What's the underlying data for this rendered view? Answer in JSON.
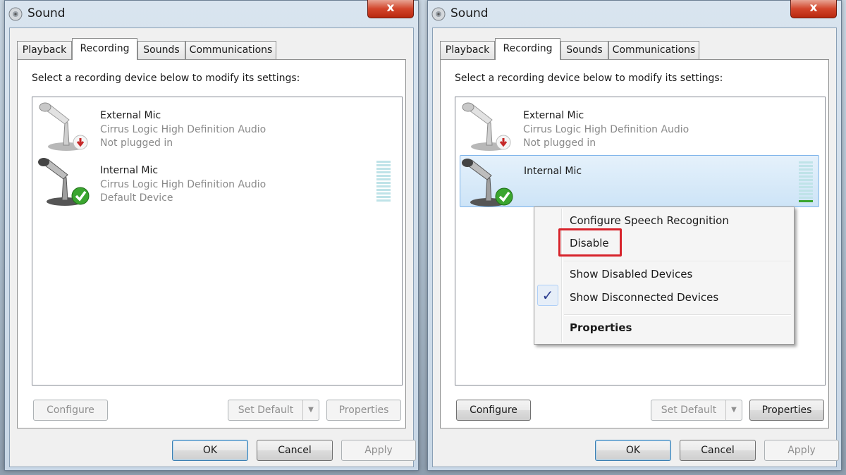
{
  "dialogs": [
    {
      "title": "Sound",
      "close_symbol": "x",
      "tabs": [
        "Playback",
        "Recording",
        "Sounds",
        "Communications"
      ],
      "active_tab": "Recording",
      "instruction": "Select a recording device below to modify its settings:",
      "devices": [
        {
          "name": "External Mic",
          "driver": "Cirrus Logic High Definition Audio",
          "status": "Not plugged in"
        },
        {
          "name": "Internal Mic",
          "driver": "Cirrus Logic High Definition Audio",
          "status": "Default Device"
        }
      ],
      "panel_buttons": {
        "configure": "Configure",
        "set_default": "Set Default",
        "properties": "Properties"
      },
      "footer_buttons": {
        "ok": "OK",
        "cancel": "Cancel",
        "apply": "Apply"
      }
    },
    {
      "title": "Sound",
      "close_symbol": "x",
      "tabs": [
        "Playback",
        "Recording",
        "Sounds",
        "Communications"
      ],
      "active_tab": "Recording",
      "instruction": "Select a recording device below to modify its settings:",
      "devices": [
        {
          "name": "External Mic",
          "driver": "Cirrus Logic High Definition Audio",
          "status": "Not plugged in"
        },
        {
          "name": "Internal Mic",
          "driver": "",
          "status": ""
        }
      ],
      "panel_buttons": {
        "configure": "Configure",
        "set_default": "Set Default",
        "properties": "Properties"
      },
      "footer_buttons": {
        "ok": "OK",
        "cancel": "Cancel",
        "apply": "Apply"
      },
      "context_menu": {
        "items": [
          "Configure Speech Recognition",
          "Disable",
          "Show Disabled Devices",
          "Show Disconnected Devices",
          "Properties"
        ],
        "checked_item": "Show Disconnected Devices",
        "highlighted_item": "Disable",
        "highlight_color": "#d7232b"
      }
    }
  ],
  "icons": {
    "title": "speaker-icon",
    "close": "close-icon",
    "external_mic": "microphone-unplugged-icon",
    "internal_mic": "microphone-default-icon",
    "check": "checkmark-icon",
    "dropdown": "chevron-down-icon"
  },
  "colors": {
    "close_button": "#d2452b",
    "default_badge": "#3aa52f",
    "unplugged_badge": "#c62828",
    "selection": "#cde4f7",
    "level_meter": "#bfe3e8",
    "level_active": "#3aa52f"
  }
}
